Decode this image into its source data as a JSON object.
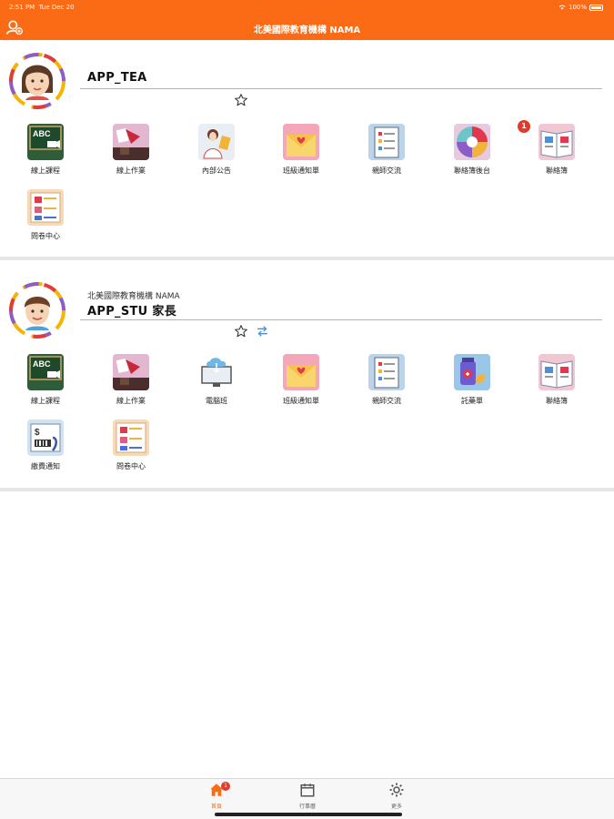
{
  "status_bar": {
    "time": "2:51 PM",
    "date": "Tue Dec 20",
    "battery": "100%"
  },
  "header": {
    "title": "北美國際教育機構 NAMA"
  },
  "accounts": [
    {
      "org": "",
      "name": "APP_TEA",
      "apps": [
        {
          "label": "線上課程",
          "icon": "online-course-icon",
          "badge": ""
        },
        {
          "label": "線上作業",
          "icon": "online-homework-icon",
          "badge": ""
        },
        {
          "label": "內部公告",
          "icon": "internal-announcement-icon",
          "badge": ""
        },
        {
          "label": "班級通知單",
          "icon": "class-notice-icon",
          "badge": ""
        },
        {
          "label": "親師交流",
          "icon": "parent-teacher-icon",
          "badge": ""
        },
        {
          "label": "聯絡簿後台",
          "icon": "contact-book-admin-icon",
          "badge": ""
        },
        {
          "label": "聯絡簿",
          "icon": "contact-book-icon",
          "badge": "1"
        },
        {
          "label": "問卷中心",
          "icon": "survey-center-icon",
          "badge": ""
        }
      ]
    },
    {
      "org": "北美國際教育機構 NAMA",
      "name": "APP_STU 家長",
      "apps": [
        {
          "label": "線上課程",
          "icon": "online-course-icon",
          "badge": ""
        },
        {
          "label": "線上作業",
          "icon": "online-homework-icon",
          "badge": ""
        },
        {
          "label": "電腦班",
          "icon": "computer-class-icon",
          "badge": ""
        },
        {
          "label": "班級通知單",
          "icon": "class-notice-icon",
          "badge": ""
        },
        {
          "label": "親師交流",
          "icon": "parent-teacher-icon",
          "badge": ""
        },
        {
          "label": "託藥單",
          "icon": "medicine-request-icon",
          "badge": ""
        },
        {
          "label": "聯絡簿",
          "icon": "contact-book-icon",
          "badge": ""
        },
        {
          "label": "繳費通知",
          "icon": "payment-notice-icon",
          "badge": ""
        },
        {
          "label": "問卷中心",
          "icon": "survey-center-icon",
          "badge": ""
        }
      ]
    }
  ],
  "tabbar": [
    {
      "label": "首頁",
      "icon": "home-icon",
      "badge": "1",
      "active": true
    },
    {
      "label": "行事曆",
      "icon": "calendar-icon",
      "badge": "",
      "active": false
    },
    {
      "label": "更多",
      "icon": "gear-icon",
      "badge": "",
      "active": false
    }
  ],
  "colors": {
    "accent": "#fb6a14",
    "badge": "#e43a2b",
    "divider": "#e6e6e6"
  }
}
